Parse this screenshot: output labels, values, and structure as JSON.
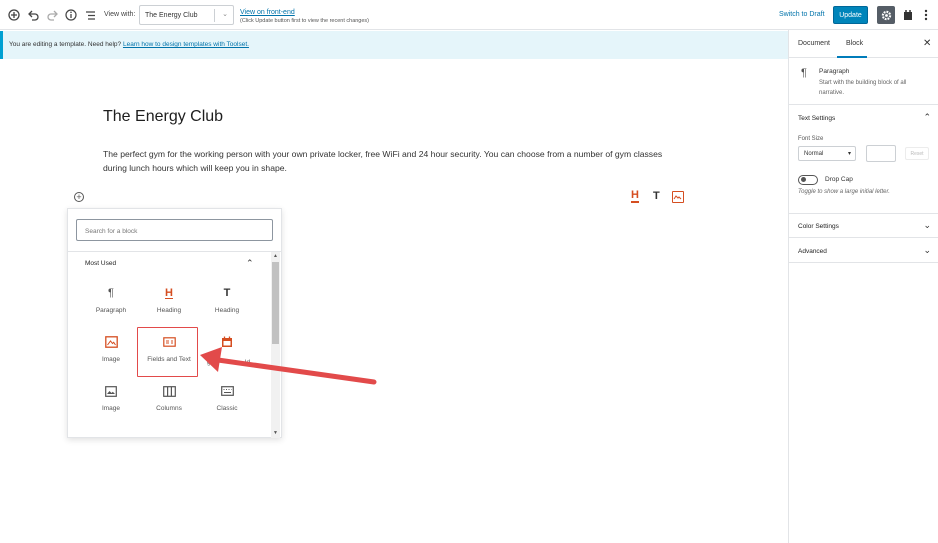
{
  "toolbar": {
    "view_with_label": "View with:",
    "template_selected": "The Energy Club",
    "view_front_end": "View on front-end",
    "view_front_end_hint": "(Click Update button first to view the recent changes)",
    "switch_to_draft": "Switch to Draft",
    "update_label": "Update"
  },
  "notice": {
    "text": "You are editing a template. Need help?",
    "link": "Learn how to design templates with Toolset."
  },
  "sidebar": {
    "tabs": [
      {
        "label": "Document"
      },
      {
        "label": "Block"
      }
    ],
    "block_name": "Paragraph",
    "block_description": "Start with the building block of all narrative.",
    "text_settings": "Text Settings",
    "font_size_label": "Font Size",
    "font_size_selected": "Normal",
    "reset_label": "Reset",
    "drop_cap_label": "Drop Cap",
    "drop_cap_help": "Toggle to show a large initial letter.",
    "color_settings": "Color Settings",
    "advanced": "Advanced"
  },
  "editor": {
    "title": "The Energy Club",
    "paragraph": "The perfect gym for the working person with your own private locker, free WiFi and 24 hour security. You can choose from a number of gym classes during lunch hours which will keep you in shape."
  },
  "inserter": {
    "search_placeholder": "Search for a block",
    "section_title": "Most Used",
    "blocks": [
      {
        "label": "Paragraph",
        "icon": "paragraph-icon"
      },
      {
        "label": "Heading",
        "icon": "toolset-heading-icon"
      },
      {
        "label": "Heading",
        "icon": "heading-icon"
      },
      {
        "label": "Image",
        "icon": "toolset-image-icon"
      },
      {
        "label": "Fields and Text",
        "icon": "fields-and-text-icon"
      },
      {
        "label": "",
        "icon": "calendar-icon"
      },
      {
        "label": "Image",
        "icon": "image-icon"
      },
      {
        "label": "Columns",
        "icon": "columns-icon"
      },
      {
        "label": "Classic",
        "icon": "keyboard-icon"
      }
    ],
    "obscured_label_fragment": "gle",
    "obscured_label_fragment2": "ld"
  },
  "colors": {
    "accent_blue": "#0085ba",
    "toolset_orange": "#d54e21",
    "annotation_red": "#e24a4a",
    "notice_bg": "#e5f5fa"
  }
}
